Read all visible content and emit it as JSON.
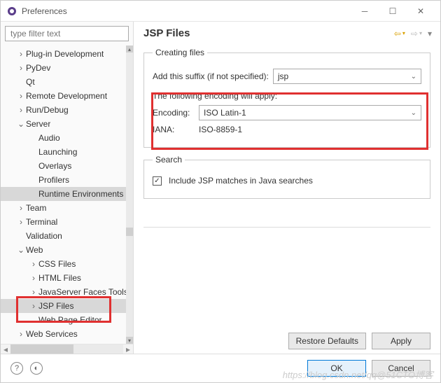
{
  "window": {
    "title": "Preferences"
  },
  "filter": {
    "placeholder": "type filter text"
  },
  "tree": {
    "items": [
      {
        "indent": 1,
        "tw": "›",
        "label": "Plug-in Development"
      },
      {
        "indent": 1,
        "tw": "›",
        "label": "PyDev"
      },
      {
        "indent": 1,
        "tw": "",
        "label": "Qt"
      },
      {
        "indent": 1,
        "tw": "›",
        "label": "Remote Development"
      },
      {
        "indent": 1,
        "tw": "›",
        "label": "Run/Debug"
      },
      {
        "indent": 1,
        "tw": "⌄",
        "label": "Server"
      },
      {
        "indent": 2,
        "tw": "",
        "label": "Audio"
      },
      {
        "indent": 2,
        "tw": "",
        "label": "Launching"
      },
      {
        "indent": 2,
        "tw": "",
        "label": "Overlays"
      },
      {
        "indent": 2,
        "tw": "",
        "label": "Profilers"
      },
      {
        "indent": 2,
        "tw": "",
        "label": "Runtime Environments",
        "hl": true
      },
      {
        "indent": 1,
        "tw": "›",
        "label": "Team"
      },
      {
        "indent": 1,
        "tw": "›",
        "label": "Terminal"
      },
      {
        "indent": 1,
        "tw": "",
        "label": "Validation"
      },
      {
        "indent": 1,
        "tw": "⌄",
        "label": "Web"
      },
      {
        "indent": 2,
        "tw": "›",
        "label": "CSS Files"
      },
      {
        "indent": 2,
        "tw": "›",
        "label": "HTML Files"
      },
      {
        "indent": 2,
        "tw": "›",
        "label": "JavaServer Faces Tools"
      },
      {
        "indent": 2,
        "tw": "›",
        "label": "JSP Files",
        "selected": true
      },
      {
        "indent": 2,
        "tw": "",
        "label": "Web Page Editor"
      },
      {
        "indent": 1,
        "tw": "›",
        "label": "Web Services"
      }
    ]
  },
  "page": {
    "title": "JSP Files",
    "creating": {
      "legend": "Creating files",
      "suffix_label": "Add this suffix (if not specified):",
      "suffix_value": "jsp",
      "encoding_note": "The following encoding will apply:",
      "encoding_label": "Encoding:",
      "encoding_value": "ISO Latin-1",
      "iana_label": "IANA:",
      "iana_value": "ISO-8859-1"
    },
    "search": {
      "legend": "Search",
      "include_label": "Include JSP matches in Java searches",
      "include_checked": true
    },
    "buttons": {
      "restore": "Restore Defaults",
      "apply": "Apply",
      "ok": "OK",
      "cancel": "Cancel"
    }
  },
  "watermark": "https://blog.csdn.net/qq@51CTO博客"
}
